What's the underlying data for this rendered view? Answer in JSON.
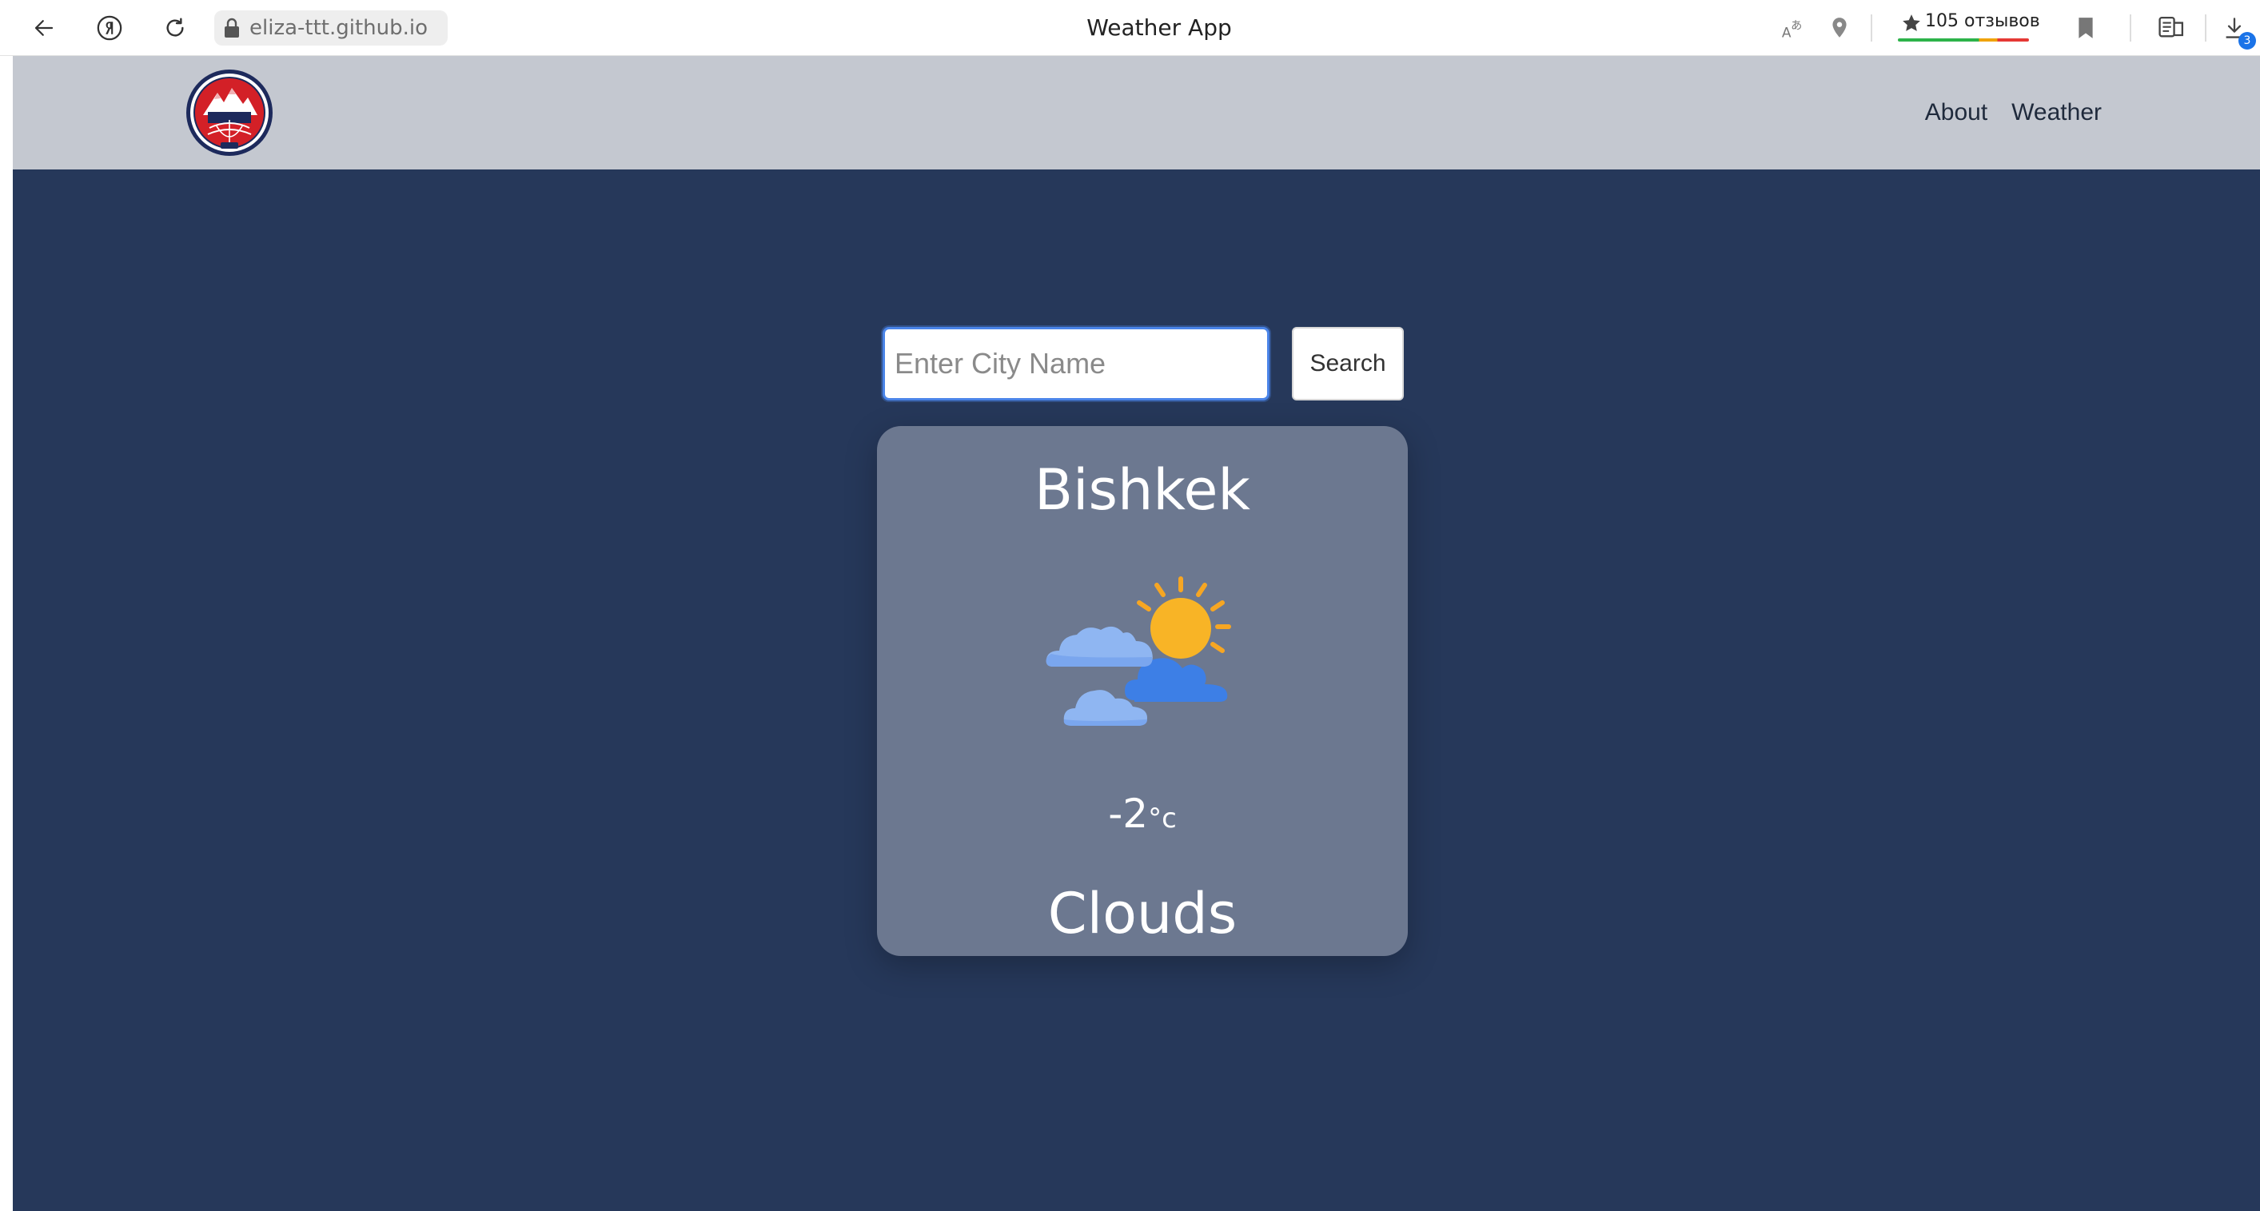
{
  "browser": {
    "url": "eliza-ttt.github.io",
    "tab_title": "Weather App",
    "reviews_label": "105 отзывов",
    "downloads_count": "3",
    "icons": [
      "back-arrow-icon",
      "yandex-icon",
      "reload-icon",
      "lock-icon",
      "translate-icon",
      "location-pin-icon",
      "star-icon",
      "bookmark-icon",
      "reader-mode-icon",
      "downloads-icon"
    ]
  },
  "header": {
    "logo_alt": "ALA-TOO",
    "nav": [
      {
        "label": "About"
      },
      {
        "label": "Weather"
      }
    ]
  },
  "search": {
    "placeholder": "Enter City Name",
    "value": "",
    "button_label": "Search"
  },
  "weather": {
    "city": "Bishkek",
    "temperature": "-2",
    "unit": "°c",
    "condition": "Clouds",
    "icon": "sun-behind-clouds-icon"
  },
  "colors": {
    "page_bg": "#26385a",
    "header_bg": "#c4c8d0",
    "card_bg": "#6c7890",
    "input_focus": "#4a84e8"
  }
}
